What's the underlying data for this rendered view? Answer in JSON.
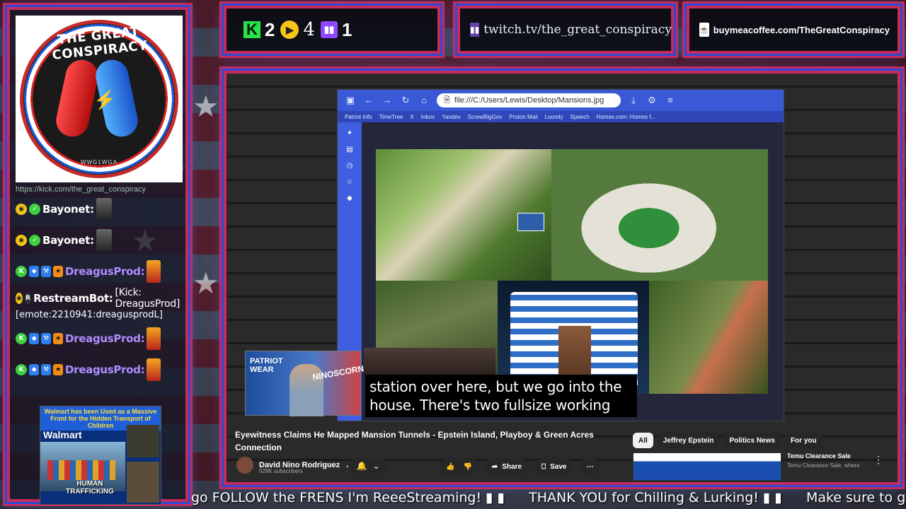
{
  "logo": {
    "title": "THE GREAT CONSPIRACY",
    "subtitle": "WWG1WGA"
  },
  "chat": {
    "top_line": "https://kick.com/the_great_conspiracy",
    "messages": [
      {
        "user": "Bayonet:",
        "text": ""
      },
      {
        "user": "Bayonet:",
        "text": ""
      },
      {
        "user": "DreagusProd:",
        "text": ""
      },
      {
        "user": "RestreamBot:",
        "text": "[Kick: DreagusProd]",
        "extra": "[emote:2210941:dreagusprodL]"
      },
      {
        "user": "DreagusProd:",
        "text": ""
      },
      {
        "user": "DreagusProd:",
        "text": ""
      }
    ]
  },
  "ad": {
    "headline": "Walmart has been Used as a Massive Front for the Hidden Transport of Children",
    "brand": "Walmart",
    "caption": "HUMAN TRAFFICKING"
  },
  "stats": {
    "kick": "2",
    "rumble": "4",
    "twitch": "1"
  },
  "links": {
    "twitch": "twitch.tv/the_great_conspiracy",
    "coffee": "buymeacoffee.com/TheGreatConspiracy"
  },
  "browser": {
    "url": "file:///C:/Users/Lewis/Desktop/Mansions.jpg",
    "bookmarks": [
      "Patriot Info",
      "TimeTree",
      "X",
      "Inbox",
      "Yandex",
      "ScrewBigGov",
      "Proton Mail",
      "Loomly",
      "Speech",
      "Homes.com: Homes f..."
    ]
  },
  "caption": {
    "line1": "station over here, but we go into the",
    "line2": "house. There's two fullsize working"
  },
  "cam": {
    "label1": "PATRIOT",
    "label2": "WEAR",
    "label3": "NINOSCORNER"
  },
  "video": {
    "title": "Eyewitness Claims He Mapped Mansion Tunnels - Epstein Island, Playboy & Green Acres Connection",
    "channel": "David Nino Rodriguez",
    "subs": "528K subscribers",
    "actions": {
      "like": "",
      "save": "Save",
      "share": "Share"
    }
  },
  "chips": [
    "All",
    "Jeffrey Epstein",
    "Politics News",
    "For you"
  ],
  "recommendation": {
    "title": "Temu Clearance Sale",
    "sub": "Temu Clearance Sale, where"
  },
  "ticker": [
    "go FOLLOW the FRENS I'm ReeeStreaming! ▮ ▮",
    "THANK YOU for Chilling & Lurking! ▮ ▮",
    "Make sure to g"
  ],
  "colors": {
    "frame": "#c62b5c",
    "glow": "#2b4bd6",
    "kick": "#27e34a",
    "rumble": "#f5c518",
    "twitch": "#9147ff"
  }
}
